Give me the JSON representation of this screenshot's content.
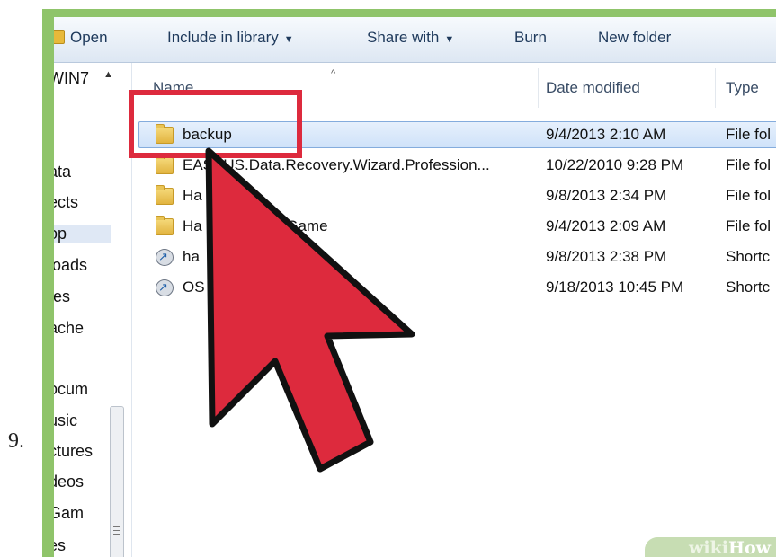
{
  "step_number": "9.",
  "toolbar": {
    "open": "Open",
    "include_in_library": "Include in library",
    "share_with": "Share with",
    "burn": "Burn",
    "new_folder": "New folder",
    "dropdown_arrow": "▼"
  },
  "nav": {
    "collapse_arrow": "▲",
    "items": [
      "WIN7",
      "ata",
      "ects",
      "op",
      "loads",
      "tes",
      "ache",
      "ocum",
      "usic",
      "ctures",
      "deos",
      "Gam",
      "es"
    ],
    "selected_index": 3
  },
  "columns": {
    "name": "Name",
    "date_modified": "Date modified",
    "type": "Type",
    "sort_caret": "^"
  },
  "files": [
    {
      "name": "backup",
      "date": "9/4/2013 2:10 AM",
      "type": "File fol",
      "icon": "folder-icon",
      "selected": true
    },
    {
      "name": "EASEUS.Data.Recovery.Wizard.Profession...",
      "date": "10/22/2010 9:28 PM",
      "type": "File fol",
      "icon": "folder-icon"
    },
    {
      "name": "Ha",
      "date": "9/8/2013 2:34 PM",
      "type": "File fol",
      "icon": "folder-icon"
    },
    {
      "name": "Ha                  l Game",
      "date": "9/4/2013 2:09 AM",
      "type": "File fol",
      "icon": "folder-icon"
    },
    {
      "name": "ha",
      "date": "9/8/2013 2:38 PM",
      "type": "Shortc",
      "icon": "shortcut-icon"
    },
    {
      "name": "OS",
      "date": "9/18/2013 10:45 PM",
      "type": "Shortc",
      "icon": "shortcut-icon"
    }
  ],
  "watermark": {
    "wiki": "wiki",
    "how": "How"
  },
  "colors": {
    "accent_red": "#dd2a3d",
    "frame_green": "#8fc46a",
    "selection_blue": "#cfe2f9"
  }
}
